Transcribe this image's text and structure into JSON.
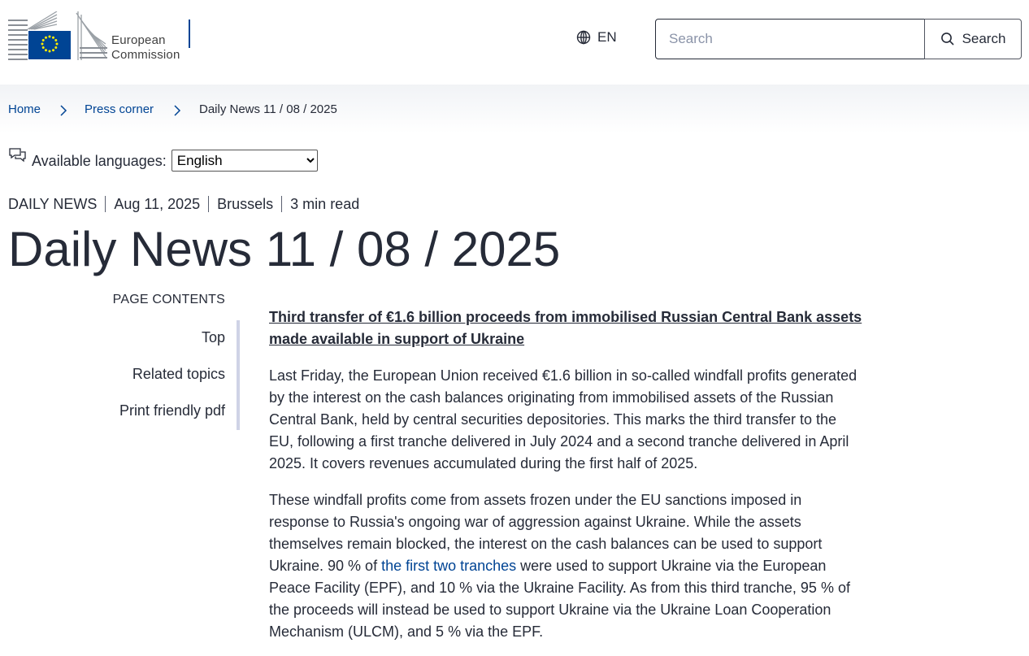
{
  "header": {
    "logo_line1": "European",
    "logo_line2": "Commission",
    "language_code": "EN",
    "search_placeholder": "Search",
    "search_button": "Search"
  },
  "breadcrumb": [
    "Home",
    "Press corner",
    "Daily News 11 / 08 / 2025"
  ],
  "languages": {
    "label": "Available languages:",
    "selected": "English"
  },
  "meta": {
    "type": "DAILY NEWS",
    "date": "Aug 11, 2025",
    "location": "Brussels",
    "read_time": "3 min read"
  },
  "page_title": "Daily News 11 / 08 / 2025",
  "toc": {
    "title": "PAGE CONTENTS",
    "items": [
      "Top",
      "Related topics",
      "Print friendly pdf"
    ]
  },
  "article": {
    "headline": "Third transfer of €1.6 billion proceeds from immobilised Russian Central Bank assets made available in support of Ukraine",
    "para1": "Last Friday, the European Union received €1.6 billion in so-called windfall profits generated by the interest on the cash balances originating from immobilised assets of the Russian Central Bank, held by central securities depositories. This marks the third transfer to the EU, following a first tranche delivered in July 2024 and a second tranche delivered in April 2025. It covers revenues accumulated during the first half of 2025.",
    "para2_before_link": "These windfall profits come from assets frozen under the EU sanctions imposed in response to Russia's ongoing war of aggression against Ukraine. While the assets themselves remain blocked, the interest on the cash balances can be used to support Ukraine. 90 % of ",
    "para2_link": "the first two tranches",
    "para2_after_link": " were used to support Ukraine via the European Peace Facility (EPF), and 10 % via the Ukraine Facility. As from this third tranche, 95 % of the proceeds will instead be used to support Ukraine via the Ukraine Loan Cooperation Mechanism (ULCM), and 5 % via the EPF."
  },
  "colors": {
    "text": "#262b38",
    "link": "#004494",
    "eu_blue": "#004494",
    "eu_star": "#ffed00",
    "rail": "#cfd3e6"
  }
}
